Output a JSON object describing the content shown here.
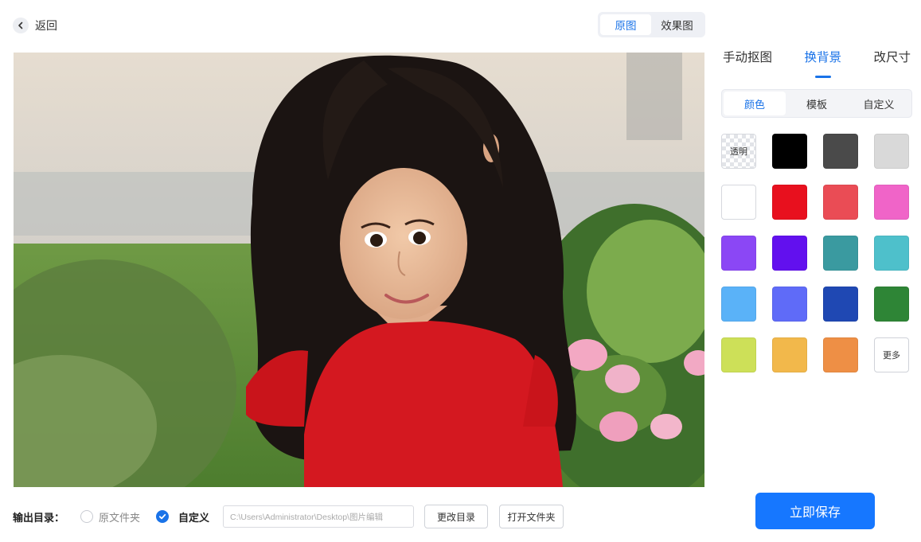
{
  "header": {
    "back_label": "返回",
    "view_toggle": {
      "original": "原图",
      "effect": "效果图"
    }
  },
  "tabs": {
    "main": [
      "手动抠图",
      "换背景",
      "改尺寸"
    ],
    "sub": [
      "颜色",
      "模板",
      "自定义"
    ]
  },
  "swatches": [
    {
      "label": "透明",
      "color": "transparent"
    },
    {
      "color": "#000000"
    },
    {
      "color": "#4a4a4a"
    },
    {
      "color": "#d9d9d9"
    },
    {
      "color": "#ffffff"
    },
    {
      "color": "#e8101e"
    },
    {
      "color": "#ea4c55"
    },
    {
      "color": "#f064c8"
    },
    {
      "color": "#8b47f5"
    },
    {
      "color": "#6210ee"
    },
    {
      "color": "#3a9aa0"
    },
    {
      "color": "#4ec0cb"
    },
    {
      "color": "#5ab2f8"
    },
    {
      "color": "#5f6bf8"
    },
    {
      "color": "#1f48b3"
    },
    {
      "color": "#2e8536"
    },
    {
      "color": "#cde058"
    },
    {
      "color": "#f2b84b"
    },
    {
      "color": "#ee8f45"
    },
    {
      "label": "更多",
      "color": "#ffffff"
    }
  ],
  "bottom": {
    "output_label": "输出目录：",
    "radio_original": "原文件夹",
    "radio_custom": "自定义",
    "path_value": "C:\\Users\\Administrator\\Desktop\\图片编辑",
    "change_dir_button": "更改目录",
    "open_folder_button": "打开文件夹",
    "save_button": "立即保存"
  },
  "colors": {
    "accent": "#1a73e8",
    "save": "#1677ff"
  }
}
